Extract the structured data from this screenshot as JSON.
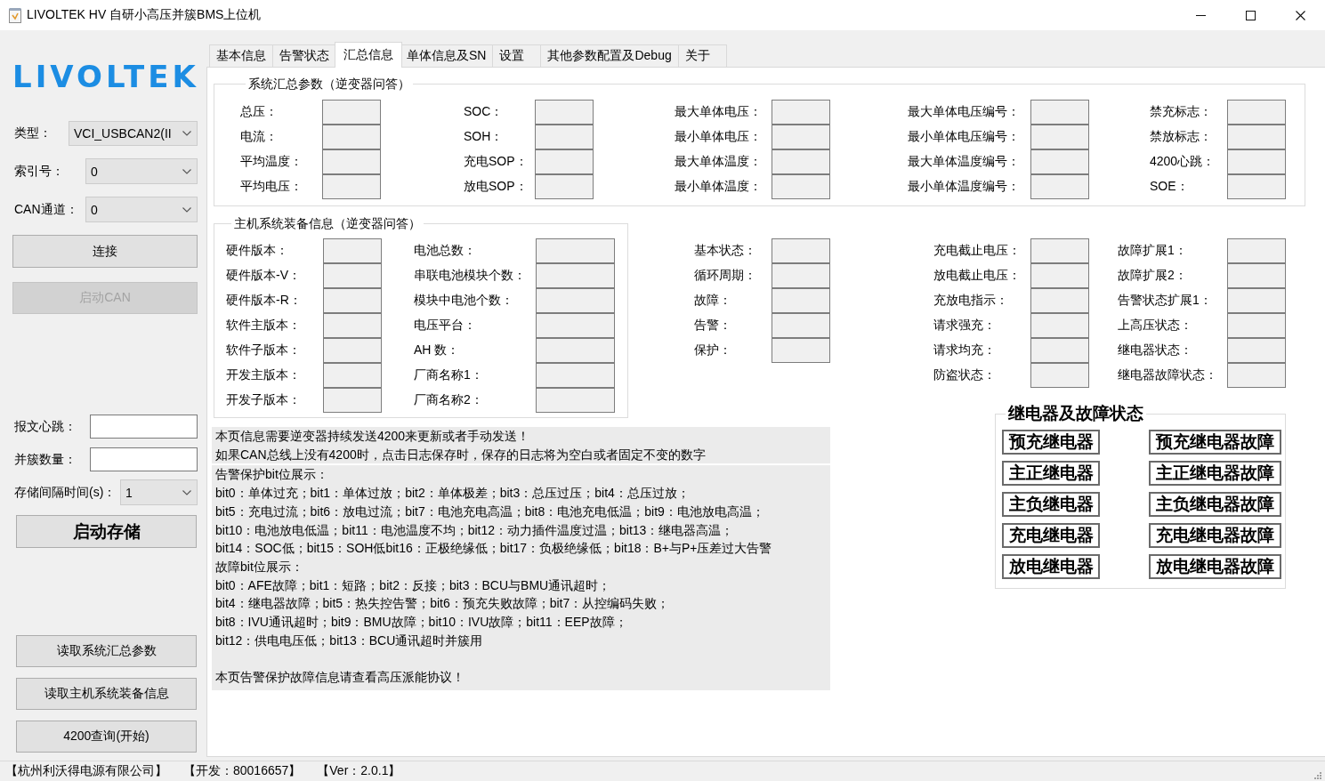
{
  "window": {
    "title": "LIVOLTEK HV 自研小高压并簇BMS上位机"
  },
  "sidebar": {
    "logo": "LIVOLTEK",
    "connection": [
      {
        "label": "类型：",
        "value": "VCI_USBCAN2(II"
      },
      {
        "label": "索引号：",
        "value": "0"
      },
      {
        "label": "CAN通道：",
        "value": "0"
      }
    ],
    "actions": [
      {
        "label": "连接",
        "disabled": false
      },
      {
        "label": "启动CAN",
        "disabled": true
      }
    ],
    "storage": [
      {
        "kind": "input",
        "label": "报文心跳："
      },
      {
        "kind": "input",
        "label": "并簇数量："
      },
      {
        "kind": "combo",
        "label": "存储间隔时间(s)：",
        "value": "1"
      }
    ],
    "store_button": "启动存储",
    "read_buttons": [
      "读取系统汇总参数",
      "读取主机系统装备信息",
      "4200查询(开始)"
    ]
  },
  "tabs": [
    {
      "label": "基本信息",
      "selected": false
    },
    {
      "label": "告警状态",
      "selected": false
    },
    {
      "label": "汇总信息",
      "selected": true
    },
    {
      "label": "单体信息及SN",
      "selected": false
    },
    {
      "label": "设置",
      "selected": false
    },
    {
      "label": "其他参数配置及Debug",
      "selected": false
    },
    {
      "label": "关于",
      "selected": false
    }
  ],
  "summary_group": {
    "title": "系统汇总参数（逆变器问答）",
    "columns": [
      [
        "总压：",
        "电流：",
        "平均温度：",
        "平均电压："
      ],
      [
        "SOC：",
        "SOH：",
        "充电SOP：",
        "放电SOP："
      ],
      [
        "最大单体电压：",
        "最小单体电压：",
        "最大单体温度：",
        "最小单体温度："
      ],
      [
        "最大单体电压编号：",
        "最小单体电压编号：",
        "最大单体温度编号：",
        "最小单体温度编号："
      ],
      [
        "禁充标志：",
        "禁放标志：",
        "4200心跳：",
        "SOE："
      ]
    ]
  },
  "device_group": {
    "title": "主机系统装备信息（逆变器问答）",
    "columns": [
      [
        "硬件版本：",
        "硬件版本-V：",
        "硬件版本-R：",
        "软件主版本：",
        "软件子版本：",
        "开发主版本：",
        "开发子版本："
      ],
      [
        "电池总数：",
        "串联电池模块个数：",
        "模块中电池个数：",
        "电压平台：",
        "AH 数：",
        "厂商名称1：",
        "厂商名称2："
      ]
    ]
  },
  "status_columns": [
    [
      "基本状态：",
      "循环周期：",
      "故障：",
      "告警：",
      "保护："
    ],
    [
      "充电截止电压：",
      "放电截止电压：",
      "充放电指示：",
      "请求强充：",
      "请求均充：",
      "防盗状态："
    ],
    [
      "故障扩展1：",
      "故障扩展2：",
      "告警状态扩展1：",
      "上高压状态：",
      "继电器状态：",
      "继电器故障状态："
    ]
  ],
  "notes": {
    "header_lines": [
      "本页信息需要逆变器持续发送4200来更新或者手动发送！",
      "如果CAN总线上没有4200时，点击日志保存时，保存的日志将为空白或者固定不变的数字"
    ],
    "lines": [
      "告警保护bit位展示：",
      "bit0：单体过充；bit1：单体过放；bit2：单体极差；bit3：总压过压；bit4：总压过放；",
      "bit5：充电过流；bit6：放电过流；bit7：电池充电高温；bit8：电池充电低温；bit9：电池放电高温；",
      "bit10：电池放电低温；bit11：电池温度不均；bit12：动力插件温度过温；bit13：继电器高温；",
      "bit14：SOC低；bit15：SOH低bit16：正极绝缘低；bit17：负极绝缘低；bit18：B+与P+压差过大告警",
      "故障bit位展示：",
      "bit0：AFE故障；bit1：短路；bit2：反接；bit3：BCU与BMU通讯超时；",
      "bit4：继电器故障；bit5：热失控告警；bit6：预充失败故障；bit7：从控编码失败；",
      "bit8：IVU通讯超时；bit9：BMU故障；bit10：IVU故障；bit11：EEP故障；",
      "bit12：供电电压低；bit13：BCU通讯超时并簇用"
    ],
    "notice": "本页告警保护故障信息请查看高压派能协议！"
  },
  "relay_group": {
    "title": "继电器及故障状态",
    "rows": [
      {
        "relay": "预充继电器",
        "fault": "预充继电器故障"
      },
      {
        "relay": "主正继电器",
        "fault": "主正继电器故障"
      },
      {
        "relay": "主负继电器",
        "fault": "主负继电器故障"
      },
      {
        "relay": "充电继电器",
        "fault": "充电继电器故障"
      },
      {
        "relay": "放电继电器",
        "fault": "放电继电器故障"
      }
    ]
  },
  "status_bar": [
    "【杭州利沃得电源有限公司】",
    "【开发：80016657】",
    "【Ver：2.0.1】"
  ]
}
